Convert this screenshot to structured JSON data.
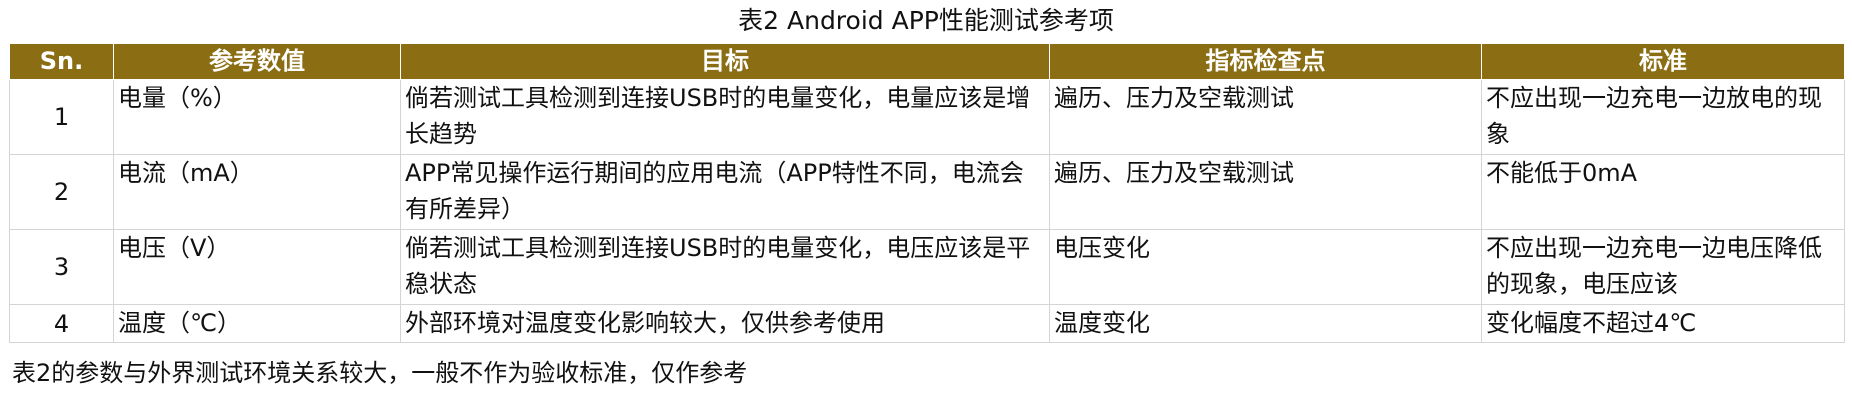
{
  "caption": "表2  Android APP性能测试参考项",
  "table": {
    "headers": [
      "Sn.",
      "参考数值",
      "目标",
      "指标检查点",
      "标准"
    ],
    "rows": [
      {
        "sn": "1",
        "param": "电量（%）",
        "target": "倘若测试工具检测到连接USB时的电量变化，电量应该是增长趋势",
        "checkpoint": "遍历、压力及空载测试",
        "standard": "不应出现一边充电一边放电的现象"
      },
      {
        "sn": "2",
        "param": "电流（mA）",
        "target": "APP常见操作运行期间的应用电流（APP特性不同，电流会有所差异）",
        "checkpoint": "遍历、压力及空载测试",
        "standard": "不能低于0mA"
      },
      {
        "sn": "3",
        "param": "电压（V）",
        "target": "倘若测试工具检测到连接USB时的电量变化，电压应该是平稳状态",
        "checkpoint": "电压变化",
        "standard": "不应出现一边充电一边电压降低的现象，电压应该"
      },
      {
        "sn": "4",
        "param": "温度（℃）",
        "target": "外部环境对温度变化影响较大，仅供参考使用",
        "checkpoint": "温度变化",
        "standard": "变化幅度不超过4℃"
      }
    ]
  },
  "footer": "表2的参数与外界测试环境关系较大，一般不作为验收标准，仅作参考",
  "colors": {
    "header_bg": "#8b6d14",
    "header_text": "#ffffff",
    "grid": "#d4d4d4"
  }
}
